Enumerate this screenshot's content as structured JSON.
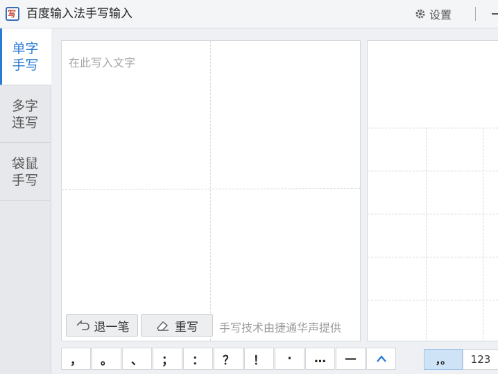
{
  "window": {
    "icon_glyph": "写",
    "title": "百度输入法手写输入",
    "settings_label": "设置"
  },
  "sidebar": {
    "tabs": [
      {
        "label": "单字手写",
        "active": true
      },
      {
        "label": "多字连写",
        "active": false
      },
      {
        "label": "袋鼠手写",
        "active": false
      }
    ]
  },
  "pad": {
    "placeholder": "在此写入文字",
    "undo_label": "退一笔",
    "clear_label": "重写",
    "credit": "手写技术由捷通华声提供"
  },
  "punctuation": {
    "keys": [
      "，",
      "。",
      "、",
      "；",
      "：",
      "？",
      "！",
      "·",
      "…",
      "—"
    ],
    "expand_icon": "chevron-up-icon"
  },
  "modes": {
    "punct_label": "，。",
    "number_label": "123"
  },
  "colors": {
    "accent": "#2a7bd3",
    "active_mode_bg": "#cfe3f7"
  }
}
